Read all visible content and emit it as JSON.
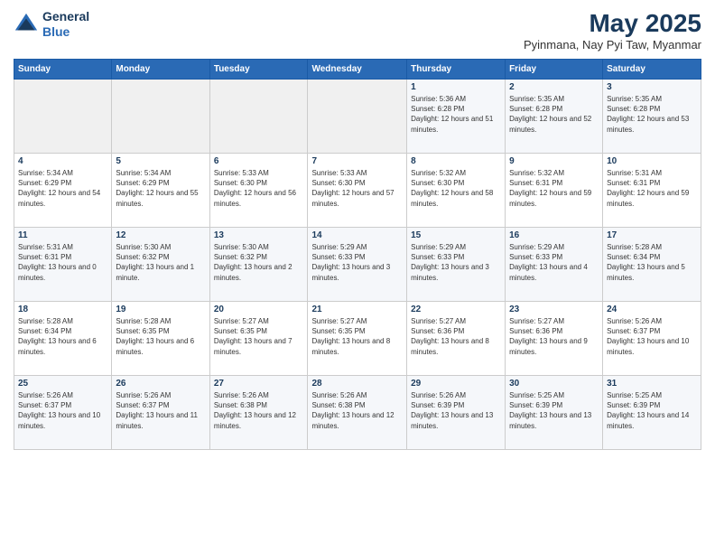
{
  "header": {
    "logo": {
      "general": "General",
      "blue": "Blue"
    },
    "title": "May 2025",
    "location": "Pyinmana, Nay Pyi Taw, Myanmar"
  },
  "weekdays": [
    "Sunday",
    "Monday",
    "Tuesday",
    "Wednesday",
    "Thursday",
    "Friday",
    "Saturday"
  ],
  "weeks": [
    [
      {
        "day": "",
        "sunrise": "",
        "sunset": "",
        "daylight": "",
        "empty": true
      },
      {
        "day": "",
        "sunrise": "",
        "sunset": "",
        "daylight": "",
        "empty": true
      },
      {
        "day": "",
        "sunrise": "",
        "sunset": "",
        "daylight": "",
        "empty": true
      },
      {
        "day": "",
        "sunrise": "",
        "sunset": "",
        "daylight": "",
        "empty": true
      },
      {
        "day": "1",
        "sunrise": "Sunrise: 5:36 AM",
        "sunset": "Sunset: 6:28 PM",
        "daylight": "Daylight: 12 hours and 51 minutes."
      },
      {
        "day": "2",
        "sunrise": "Sunrise: 5:35 AM",
        "sunset": "Sunset: 6:28 PM",
        "daylight": "Daylight: 12 hours and 52 minutes."
      },
      {
        "day": "3",
        "sunrise": "Sunrise: 5:35 AM",
        "sunset": "Sunset: 6:28 PM",
        "daylight": "Daylight: 12 hours and 53 minutes."
      }
    ],
    [
      {
        "day": "4",
        "sunrise": "Sunrise: 5:34 AM",
        "sunset": "Sunset: 6:29 PM",
        "daylight": "Daylight: 12 hours and 54 minutes."
      },
      {
        "day": "5",
        "sunrise": "Sunrise: 5:34 AM",
        "sunset": "Sunset: 6:29 PM",
        "daylight": "Daylight: 12 hours and 55 minutes."
      },
      {
        "day": "6",
        "sunrise": "Sunrise: 5:33 AM",
        "sunset": "Sunset: 6:30 PM",
        "daylight": "Daylight: 12 hours and 56 minutes."
      },
      {
        "day": "7",
        "sunrise": "Sunrise: 5:33 AM",
        "sunset": "Sunset: 6:30 PM",
        "daylight": "Daylight: 12 hours and 57 minutes."
      },
      {
        "day": "8",
        "sunrise": "Sunrise: 5:32 AM",
        "sunset": "Sunset: 6:30 PM",
        "daylight": "Daylight: 12 hours and 58 minutes."
      },
      {
        "day": "9",
        "sunrise": "Sunrise: 5:32 AM",
        "sunset": "Sunset: 6:31 PM",
        "daylight": "Daylight: 12 hours and 59 minutes."
      },
      {
        "day": "10",
        "sunrise": "Sunrise: 5:31 AM",
        "sunset": "Sunset: 6:31 PM",
        "daylight": "Daylight: 12 hours and 59 minutes."
      }
    ],
    [
      {
        "day": "11",
        "sunrise": "Sunrise: 5:31 AM",
        "sunset": "Sunset: 6:31 PM",
        "daylight": "Daylight: 13 hours and 0 minutes."
      },
      {
        "day": "12",
        "sunrise": "Sunrise: 5:30 AM",
        "sunset": "Sunset: 6:32 PM",
        "daylight": "Daylight: 13 hours and 1 minute."
      },
      {
        "day": "13",
        "sunrise": "Sunrise: 5:30 AM",
        "sunset": "Sunset: 6:32 PM",
        "daylight": "Daylight: 13 hours and 2 minutes."
      },
      {
        "day": "14",
        "sunrise": "Sunrise: 5:29 AM",
        "sunset": "Sunset: 6:33 PM",
        "daylight": "Daylight: 13 hours and 3 minutes."
      },
      {
        "day": "15",
        "sunrise": "Sunrise: 5:29 AM",
        "sunset": "Sunset: 6:33 PM",
        "daylight": "Daylight: 13 hours and 3 minutes."
      },
      {
        "day": "16",
        "sunrise": "Sunrise: 5:29 AM",
        "sunset": "Sunset: 6:33 PM",
        "daylight": "Daylight: 13 hours and 4 minutes."
      },
      {
        "day": "17",
        "sunrise": "Sunrise: 5:28 AM",
        "sunset": "Sunset: 6:34 PM",
        "daylight": "Daylight: 13 hours and 5 minutes."
      }
    ],
    [
      {
        "day": "18",
        "sunrise": "Sunrise: 5:28 AM",
        "sunset": "Sunset: 6:34 PM",
        "daylight": "Daylight: 13 hours and 6 minutes."
      },
      {
        "day": "19",
        "sunrise": "Sunrise: 5:28 AM",
        "sunset": "Sunset: 6:35 PM",
        "daylight": "Daylight: 13 hours and 6 minutes."
      },
      {
        "day": "20",
        "sunrise": "Sunrise: 5:27 AM",
        "sunset": "Sunset: 6:35 PM",
        "daylight": "Daylight: 13 hours and 7 minutes."
      },
      {
        "day": "21",
        "sunrise": "Sunrise: 5:27 AM",
        "sunset": "Sunset: 6:35 PM",
        "daylight": "Daylight: 13 hours and 8 minutes."
      },
      {
        "day": "22",
        "sunrise": "Sunrise: 5:27 AM",
        "sunset": "Sunset: 6:36 PM",
        "daylight": "Daylight: 13 hours and 8 minutes."
      },
      {
        "day": "23",
        "sunrise": "Sunrise: 5:27 AM",
        "sunset": "Sunset: 6:36 PM",
        "daylight": "Daylight: 13 hours and 9 minutes."
      },
      {
        "day": "24",
        "sunrise": "Sunrise: 5:26 AM",
        "sunset": "Sunset: 6:37 PM",
        "daylight": "Daylight: 13 hours and 10 minutes."
      }
    ],
    [
      {
        "day": "25",
        "sunrise": "Sunrise: 5:26 AM",
        "sunset": "Sunset: 6:37 PM",
        "daylight": "Daylight: 13 hours and 10 minutes."
      },
      {
        "day": "26",
        "sunrise": "Sunrise: 5:26 AM",
        "sunset": "Sunset: 6:37 PM",
        "daylight": "Daylight: 13 hours and 11 minutes."
      },
      {
        "day": "27",
        "sunrise": "Sunrise: 5:26 AM",
        "sunset": "Sunset: 6:38 PM",
        "daylight": "Daylight: 13 hours and 12 minutes."
      },
      {
        "day": "28",
        "sunrise": "Sunrise: 5:26 AM",
        "sunset": "Sunset: 6:38 PM",
        "daylight": "Daylight: 13 hours and 12 minutes."
      },
      {
        "day": "29",
        "sunrise": "Sunrise: 5:26 AM",
        "sunset": "Sunset: 6:39 PM",
        "daylight": "Daylight: 13 hours and 13 minutes."
      },
      {
        "day": "30",
        "sunrise": "Sunrise: 5:25 AM",
        "sunset": "Sunset: 6:39 PM",
        "daylight": "Daylight: 13 hours and 13 minutes."
      },
      {
        "day": "31",
        "sunrise": "Sunrise: 5:25 AM",
        "sunset": "Sunset: 6:39 PM",
        "daylight": "Daylight: 13 hours and 14 minutes."
      }
    ]
  ]
}
